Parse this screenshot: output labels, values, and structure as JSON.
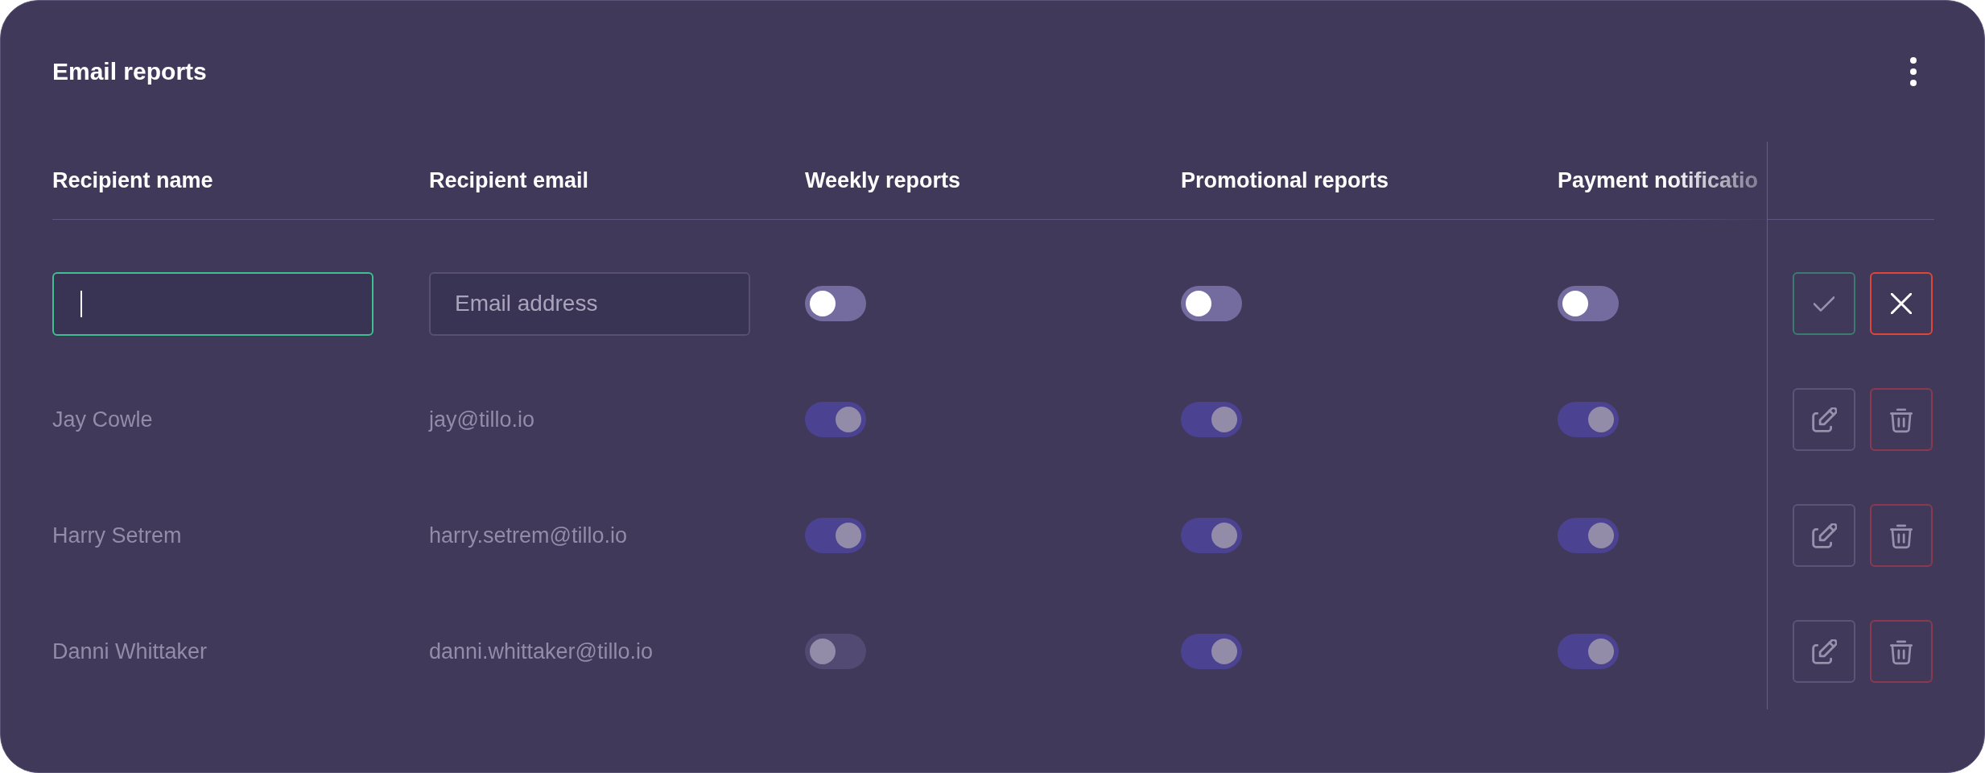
{
  "card": {
    "title": "Email reports"
  },
  "table": {
    "columns": [
      "Recipient name",
      "Recipient email",
      "Weekly reports",
      "Promotional reports",
      "Payment notificatio"
    ],
    "rows": [
      {
        "kind": "input",
        "name_field": {
          "focused": true
        },
        "email_field": {
          "placeholder": "Email address",
          "focused": false
        },
        "toggles": [
          {
            "on": false,
            "disabled": false
          },
          {
            "on": false,
            "disabled": false
          },
          {
            "on": false,
            "disabled": false
          }
        ],
        "actions": [
          {
            "kind": "confirm",
            "disabled": true
          },
          {
            "kind": "cancel",
            "disabled": false
          }
        ]
      },
      {
        "kind": "entry",
        "name": "Jay Cowle",
        "email": "jay@tillo.io",
        "toggles": [
          {
            "on": true,
            "disabled": true
          },
          {
            "on": true,
            "disabled": true
          },
          {
            "on": true,
            "disabled": true
          }
        ],
        "actions": [
          {
            "kind": "edit",
            "disabled": true
          },
          {
            "kind": "delete",
            "disabled": true
          }
        ]
      },
      {
        "kind": "entry",
        "name": "Harry Setrem",
        "email": "harry.setrem@tillo.io",
        "toggles": [
          {
            "on": true,
            "disabled": true
          },
          {
            "on": true,
            "disabled": true
          },
          {
            "on": true,
            "disabled": true
          }
        ],
        "actions": [
          {
            "kind": "edit",
            "disabled": true
          },
          {
            "kind": "delete",
            "disabled": true
          }
        ]
      },
      {
        "kind": "entry",
        "name": "Danni Whittaker",
        "email": "danni.whittaker@tillo.io",
        "toggles": [
          {
            "on": false,
            "disabled": true
          },
          {
            "on": true,
            "disabled": true
          },
          {
            "on": true,
            "disabled": true
          }
        ],
        "actions": [
          {
            "kind": "edit",
            "disabled": true
          },
          {
            "kind": "delete",
            "disabled": true
          }
        ]
      }
    ]
  }
}
